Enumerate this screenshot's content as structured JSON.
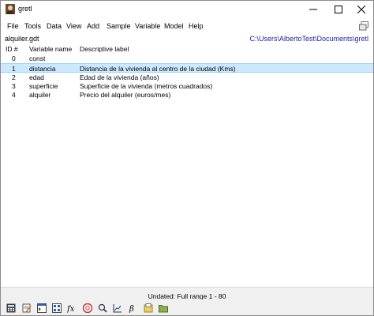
{
  "window": {
    "title": "gretl"
  },
  "menu": {
    "items": [
      "File",
      "Tools",
      "Data",
      "View",
      "Add",
      "Sample",
      "Variable",
      "Model",
      "Help"
    ]
  },
  "info": {
    "filename": "alquiler.gdt",
    "workdir": "C:\\Users\\AlbertoTest\\Documents\\gretl"
  },
  "table": {
    "headers": [
      "ID #",
      "Variable name",
      "Descriptive label"
    ],
    "rows": [
      {
        "id": "0",
        "name": "const",
        "label": "",
        "selected": false
      },
      {
        "id": "1",
        "name": "distancia",
        "label": "Distancia de la vivienda al centro de la ciudad (Kms)",
        "selected": true
      },
      {
        "id": "2",
        "name": "edad",
        "label": "Edad de la vivienda (años)",
        "selected": false
      },
      {
        "id": "3",
        "name": "superficie",
        "label": "Superficie de la vivienda (metros cuadrados)",
        "selected": false
      },
      {
        "id": "4",
        "name": "alquiler",
        "label": "Precio del alquiler (euros/mes)",
        "selected": false
      }
    ]
  },
  "status": {
    "text": "Undated: Full range 1 - 80"
  },
  "toolbar": {
    "icons": [
      "calculator-icon",
      "edit-script-icon",
      "terminal-icon",
      "session-icon",
      "function-fx-icon",
      "help-icon",
      "search-icon",
      "plot-icon",
      "beta-model-icon",
      "open-dataset-icon",
      "open-folder-icon"
    ]
  },
  "colors": {
    "selection": "#cce8ff",
    "workdir": "#2020a8"
  }
}
